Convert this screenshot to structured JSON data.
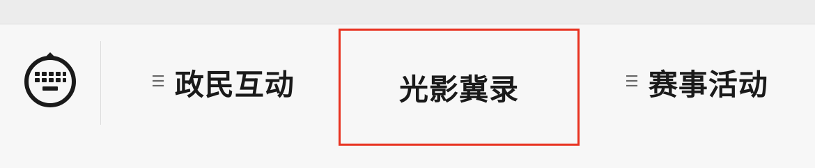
{
  "keyboard_toggle": {
    "icon": "keyboard-icon"
  },
  "menu": {
    "items": [
      {
        "label": "政民互动",
        "icon": "menu-lines-icon",
        "selected": false
      },
      {
        "label": "光影冀录",
        "icon": "",
        "selected": true
      },
      {
        "label": "赛事活动",
        "icon": "menu-lines-icon",
        "selected": false
      }
    ]
  },
  "colors": {
    "selection_border": "#e8311f",
    "text": "#1a1a1a",
    "background": "#f7f7f7",
    "top_strip": "#ececec"
  }
}
